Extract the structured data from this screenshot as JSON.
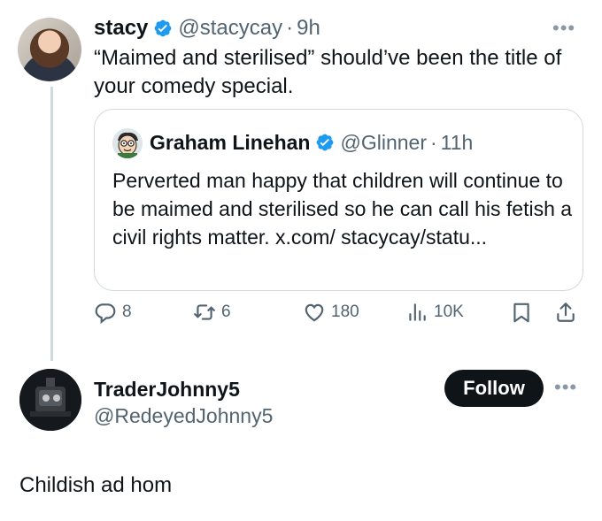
{
  "tweet": {
    "author_name": "stacy",
    "author_handle": "@stacycay",
    "time": "9h",
    "text": "“Maimed and sterilised” should’ve been the title of your comedy special.",
    "more_icon": "more-horizontal-icon",
    "avatar": "profile-photo",
    "quote": {
      "author_name": "Graham Linehan",
      "author_handle": "@Glinner",
      "time": "11h",
      "text": "Perverted man happy that children will continue to be maimed and sterilised so he can call his fetish a civil rights matter. x.com/ stacycay/statu..."
    },
    "actions": {
      "replies": "8",
      "retweets": "6",
      "likes": "180",
      "views": "10K",
      "icons": [
        "reply-icon",
        "retweet-icon",
        "like-icon",
        "views-icon",
        "bookmark-icon",
        "share-icon"
      ]
    }
  },
  "reply": {
    "author_name": "TraderJohnny5",
    "author_handle": "@RedeyedJohnny5",
    "follow_label": "Follow",
    "text": "Childish ad hom"
  },
  "colors": {
    "text": "#0f1419",
    "secondary": "#536471",
    "verified": "#1d9bf0",
    "border": "#cfd9de",
    "follow_bg": "#0f1419"
  }
}
